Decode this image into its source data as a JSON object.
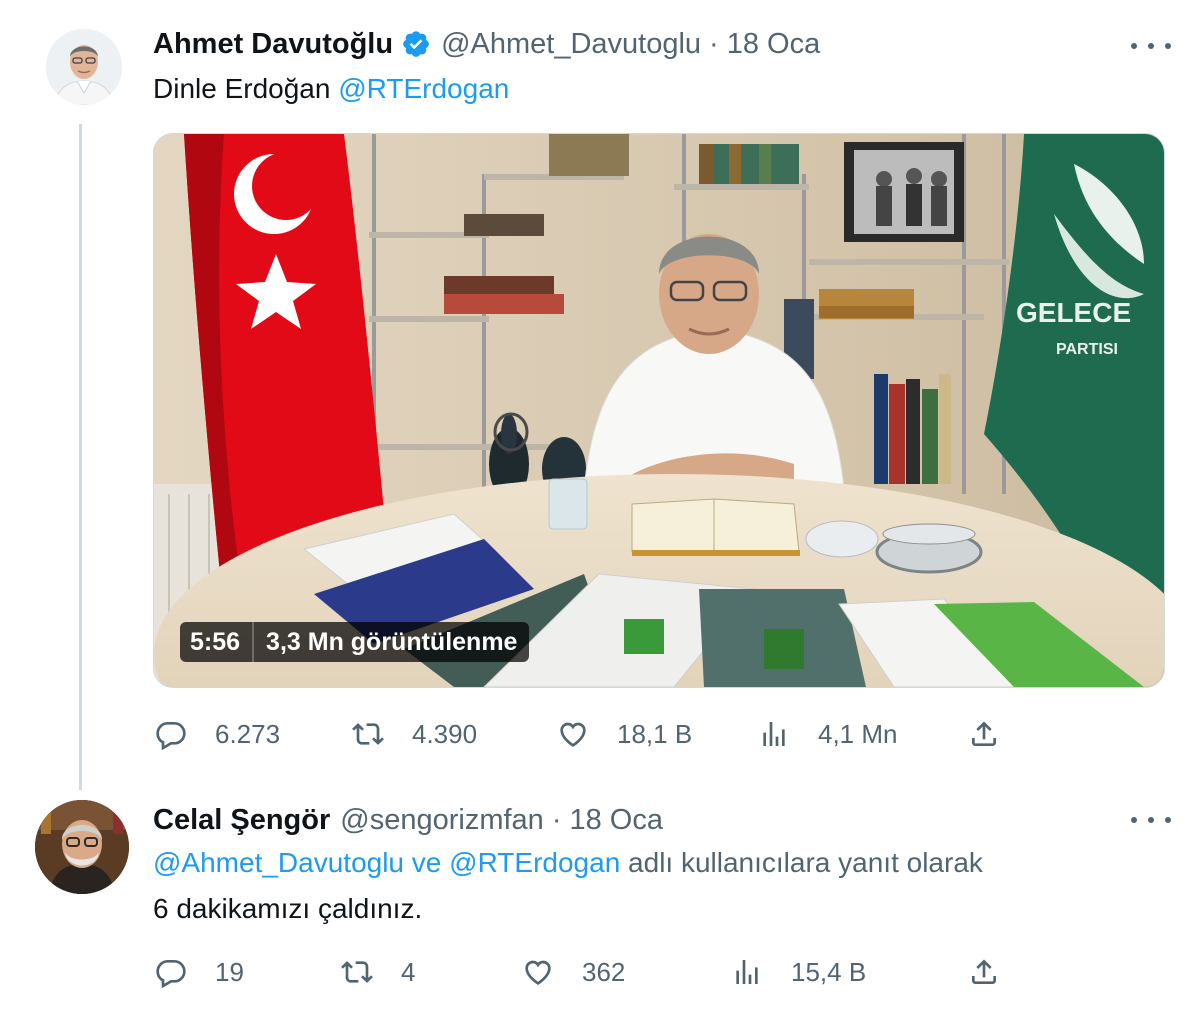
{
  "tweets": [
    {
      "name": "Ahmet Davutoğlu",
      "verified": true,
      "handle": "@Ahmet_Davutoglu",
      "separator": "·",
      "date": "18 Oca",
      "text_plain": "Dinle Erdoğan ",
      "text_mention": "@RTErdogan",
      "video": {
        "duration": "5:56",
        "views": "3,3 Mn görüntülenme",
        "sign_text_1": "GELECE",
        "sign_text_2": "PARTISI"
      },
      "stats": {
        "replies": "6.273",
        "retweets": "4.390",
        "likes": "18,1 B",
        "views": "4,1 Mn"
      }
    },
    {
      "name": "Celal Şengör",
      "handle": "@sengorizmfan",
      "separator": "·",
      "date": "18 Oca",
      "reply_mention_1": "@Ahmet_Davutoglu",
      "reply_connector": " ve ",
      "reply_mention_2": "@RTErdogan",
      "reply_suffix": " adlı kullanıcılara yanıt olarak",
      "text": "6 dakikamızı çaldınız.",
      "stats": {
        "replies": "19",
        "retweets": "4",
        "likes": "362",
        "views": "15,4 B"
      }
    }
  ],
  "colors": {
    "accent": "#1d9bf0",
    "secondary": "#536471",
    "text": "#0f1419",
    "flag_red": "#e30a17",
    "party_green": "#1f6b4f"
  },
  "icons": [
    "verified-badge-icon",
    "more-icon",
    "reply-icon",
    "retweet-icon",
    "like-icon",
    "views-icon",
    "share-icon"
  ]
}
